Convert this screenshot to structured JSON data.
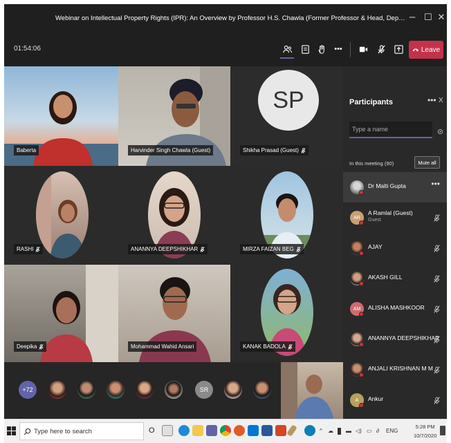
{
  "window": {
    "title": "Webinar on Intellectual Property Rights (IPR): An Overview by Professor H.S. Chawla (Former Professor & Head, Department of Genetics and Plant Breeding, G...",
    "minimize": "–",
    "maximize": "☐",
    "close": "✕"
  },
  "toolbar": {
    "timer": "01:54:06",
    "leave_label": "Leave",
    "more": "•••"
  },
  "videos": [
    {
      "name": "Baberta"
    },
    {
      "name": "Harvinder Singh Chawla (Guest)"
    },
    {
      "name": "Shikha Prasad (Guest)",
      "initials": "SP"
    },
    {
      "name": "RASHI"
    },
    {
      "name": "ANANNYA DEEPSHIKHAR"
    },
    {
      "name": "MIRZA FAIZAN BEG"
    },
    {
      "name": "Deepika"
    },
    {
      "name": "Mohammad Wahid Ansari"
    },
    {
      "name": "KANAK BADOLA"
    }
  ],
  "strip": {
    "overflow_count": "+72",
    "initials_avatar": "SR"
  },
  "participants": {
    "title": "Participants",
    "more": "•••",
    "close": "X",
    "search_placeholder": "Type a name",
    "in_meeting_label": "In this meeting (90)",
    "mute_all_label": "Mute all",
    "list": [
      {
        "name": "Dr Malti Gupta",
        "sub": "",
        "initials": ""
      },
      {
        "name": "A Ramlal (Guest)",
        "sub": "Guest",
        "initials": "AR"
      },
      {
        "name": "AJAY",
        "sub": "",
        "initials": ""
      },
      {
        "name": "AKASH GILL",
        "sub": "",
        "initials": ""
      },
      {
        "name": "ALISHA MASHKOOR",
        "sub": "",
        "initials": "AM"
      },
      {
        "name": "ANANNYA DEEPSHIKHAR",
        "sub": "",
        "initials": ""
      },
      {
        "name": "ANJALI KRISHNAN M M",
        "sub": "",
        "initials": ""
      },
      {
        "name": "Ankur",
        "sub": "",
        "initials": "A"
      }
    ]
  },
  "taskbar": {
    "search_placeholder": "Type here to search",
    "language": "ENG",
    "time": "5:28 PM",
    "date": "10/7/2020",
    "task_view_label": "O"
  },
  "colors": {
    "accent": "#6264a7",
    "leave": "#c4314b",
    "status_red": "#d13438"
  }
}
